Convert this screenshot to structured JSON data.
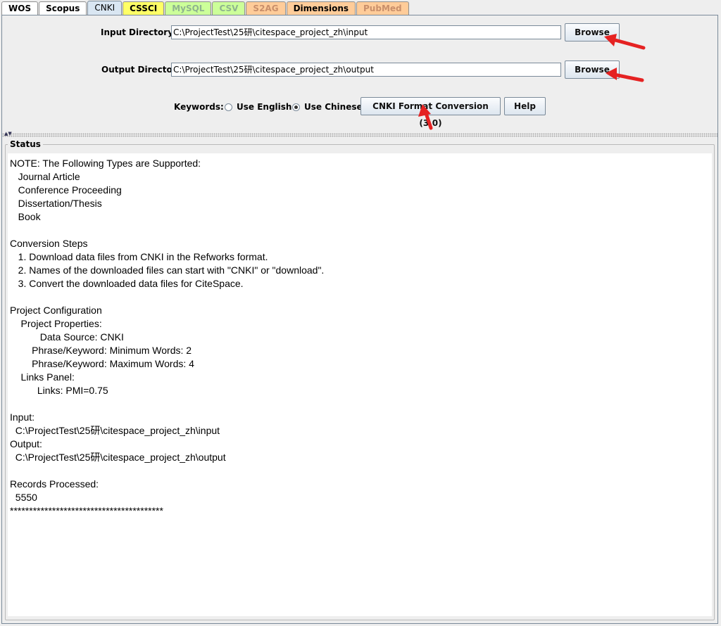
{
  "tabs": [
    {
      "label": "WOS",
      "bg": "#ffffff",
      "color": "#000000",
      "selected": false
    },
    {
      "label": "Scopus",
      "bg": "#ffffff",
      "color": "#000000",
      "selected": false
    },
    {
      "label": "CNKI",
      "bg": "#d9e6f2",
      "color": "#000000",
      "selected": true
    },
    {
      "label": "CSSCI",
      "bg": "#ffff66",
      "color": "#000000",
      "selected": false
    },
    {
      "label": "MySQL",
      "bg": "#ccff99",
      "color": "#8fb38f",
      "selected": false
    },
    {
      "label": "CSV",
      "bg": "#ccff99",
      "color": "#8fb38f",
      "selected": false
    },
    {
      "label": "S2AG",
      "bg": "#ffcc99",
      "color": "#c98f6b",
      "selected": false
    },
    {
      "label": "Dimensions",
      "bg": "#ffcc99",
      "color": "#000000",
      "selected": false
    },
    {
      "label": "PubMed",
      "bg": "#ffcc99",
      "color": "#c98f6b",
      "selected": false
    }
  ],
  "input_dir": {
    "label": "Input Directory",
    "value": "C:\\ProjectTest\\25研\\citespace_project_zh\\input",
    "browse_label": "Browse"
  },
  "output_dir": {
    "label": "Output Directory",
    "value": "C:\\ProjectTest\\25研\\citespace_project_zh\\output",
    "browse_label": "Browse"
  },
  "keywords": {
    "label": "Keywords:",
    "options": [
      {
        "label": "Use English",
        "checked": false
      },
      {
        "label": "Use Chinese",
        "checked": true
      }
    ]
  },
  "convert_button": "CNKI Format Conversion (3.0)",
  "help_button": "Help",
  "status": {
    "title": "Status",
    "lines": [
      "NOTE: The Following Types are Supported:",
      "   Journal Article",
      "   Conference Proceeding",
      "   Dissertation/Thesis",
      "   Book",
      "",
      "Conversion Steps",
      "   1. Download data files from CNKI in the Refworks format.",
      "   2. Names of the downloaded files can start with \"CNKI\" or \"download\".",
      "   3. Convert the downloaded data files for CiteSpace.",
      "",
      "Project Configuration",
      "    Project Properties:",
      "           Data Source: CNKI",
      "        Phrase/Keyword: Minimum Words: 2",
      "        Phrase/Keyword: Maximum Words: 4",
      "    Links Panel:",
      "          Links: PMI=0.75",
      "",
      "Input:",
      "  C:\\ProjectTest\\25研\\citespace_project_zh\\input",
      "Output:",
      "  C:\\ProjectTest\\25研\\citespace_project_zh\\output",
      "",
      "Records Processed:",
      "  5550",
      "****************************************"
    ]
  },
  "colors": {
    "annotation_arrow": "#e52222"
  }
}
